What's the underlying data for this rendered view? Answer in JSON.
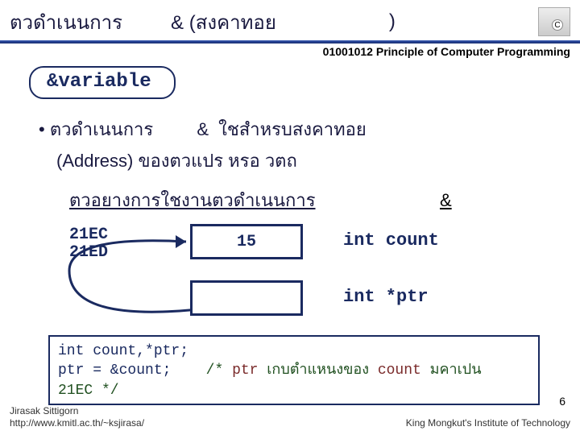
{
  "header": {
    "title": "ตวดำเนนการ",
    "op": "& (สงคาทอย",
    "paren": ")"
  },
  "course": "01001012 Principle of Computer Programming",
  "pill": "&variable",
  "bullet": {
    "text1": "ตวดำเนนการ",
    "amp": "&",
    "text2": "ใชสำหรบสงคาทอย"
  },
  "subline": "(Address) ของตวแปร    หรอ    วตถ",
  "example_title": "ตวอยางการใชงานตวดำเนนการ",
  "example_amp": "&",
  "diagram": {
    "addr1": "21EC",
    "addr2": "21ED",
    "box1_val": "15",
    "label1": "int count",
    "label2": "int *ptr"
  },
  "code": {
    "line1": "int  count,*ptr;",
    "line2a": "ptr = &count;",
    "line2b": "/* ",
    "line2c": "ptr",
    "line2d": " เกบตำแหนงของ     ",
    "line2e": "count",
    "line2f": " มคาเปน",
    "line3": "21EC */"
  },
  "footer": {
    "author": "Jirasak Sittigorn",
    "url": "http://www.kmitl.ac.th/~ksjirasa/",
    "inst": "King Mongkut's Institute of Technology",
    "page": "6"
  }
}
